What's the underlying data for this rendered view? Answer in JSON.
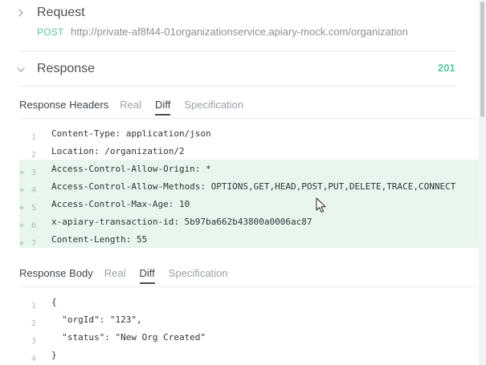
{
  "request": {
    "title": "Request",
    "method": "POST",
    "url": "http://private-af8f44-01organizationservice.apiary-mock.com/organization",
    "expander_icon": "chevron-right-icon"
  },
  "response": {
    "title": "Response",
    "status_code": "201",
    "expander_icon": "chevron-down-icon"
  },
  "headers_section": {
    "heading": "Response Headers",
    "tabs": [
      {
        "label": "Real",
        "active": false
      },
      {
        "label": "Diff",
        "active": true
      },
      {
        "label": "Specification",
        "active": false
      }
    ],
    "lines": [
      {
        "num": "1",
        "added": false,
        "text": "Content-Type: application/json"
      },
      {
        "num": "2",
        "added": false,
        "text": "Location: /organization/2"
      },
      {
        "num": "3",
        "added": true,
        "text": "Access-Control-Allow-Origin: *"
      },
      {
        "num": "4",
        "added": true,
        "text": "Access-Control-Allow-Methods: OPTIONS,GET,HEAD,POST,PUT,DELETE,TRACE,CONNECT"
      },
      {
        "num": "5",
        "added": true,
        "text": "Access-Control-Max-Age: 10"
      },
      {
        "num": "6",
        "added": true,
        "text": "x-apiary-transaction-id: 5b97ba662b43800a0006ac87"
      },
      {
        "num": "7",
        "added": true,
        "text": "Content-Length: 55"
      }
    ]
  },
  "body_section": {
    "heading": "Response Body",
    "tabs": [
      {
        "label": "Real",
        "active": false
      },
      {
        "label": "Diff",
        "active": true
      },
      {
        "label": "Specification",
        "active": false
      }
    ],
    "lines": [
      {
        "num": "1",
        "added": false,
        "text": "{"
      },
      {
        "num": "2",
        "added": false,
        "text": "  \"orgId\": \"123\","
      },
      {
        "num": "3",
        "added": false,
        "text": "  \"status\": \"New Org Created\""
      },
      {
        "num": "4",
        "added": false,
        "text": "}"
      }
    ]
  },
  "added_marker": "+",
  "colors": {
    "accent_green": "#5cc69a",
    "added_row_bg": "#e8f6ee",
    "muted_text": "#9aa0a6"
  }
}
